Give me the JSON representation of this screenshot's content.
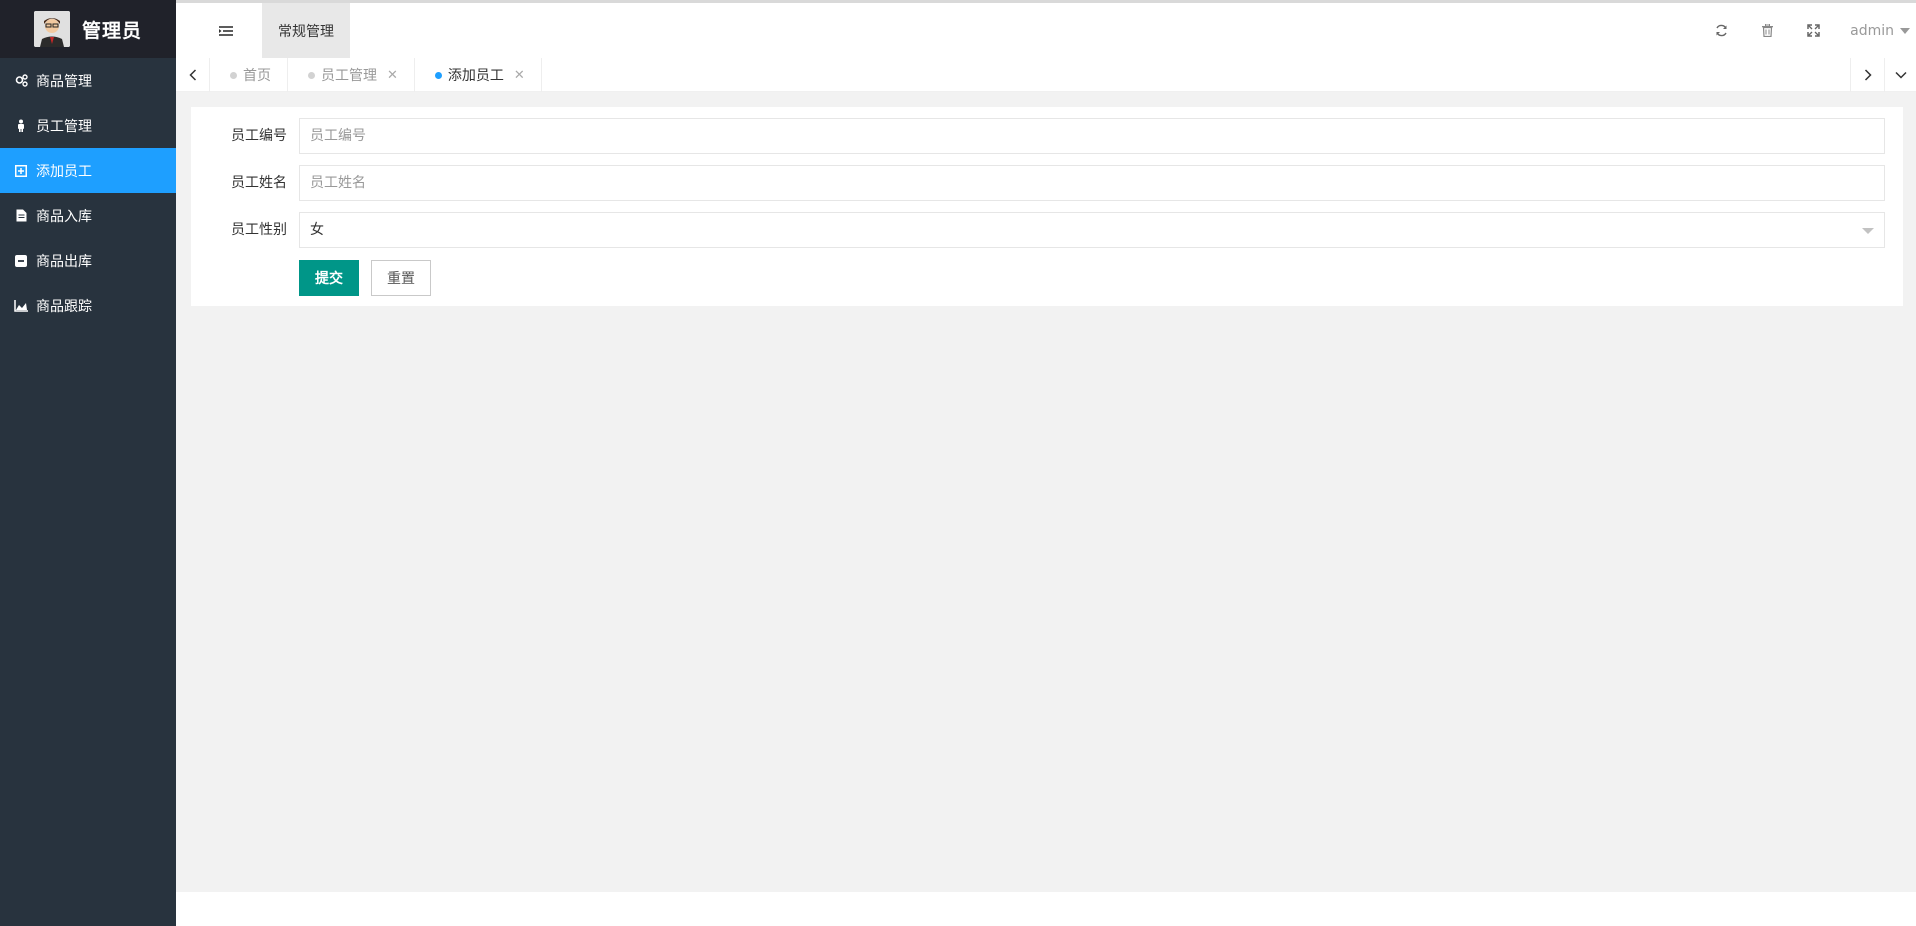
{
  "sidebar": {
    "logo_text": "管理员",
    "items": [
      {
        "label": "商品管理",
        "icon": "gears-icon",
        "active": false
      },
      {
        "label": "员工管理",
        "icon": "person-icon",
        "active": false
      },
      {
        "label": "添加员工",
        "icon": "add-square-icon",
        "active": true
      },
      {
        "label": "商品入库",
        "icon": "file-icon",
        "active": false
      },
      {
        "label": "商品出库",
        "icon": "minus-square-icon",
        "active": false
      },
      {
        "label": "商品跟踪",
        "icon": "area-chart-icon",
        "active": false
      }
    ]
  },
  "header": {
    "nav_label": "常规管理",
    "user": "admin",
    "tools": [
      "refresh-icon",
      "trash-icon",
      "fullscreen-icon"
    ]
  },
  "tabs": [
    {
      "label": "首页",
      "active": false,
      "closable": false
    },
    {
      "label": "员工管理",
      "active": false,
      "closable": true
    },
    {
      "label": "添加员工",
      "active": true,
      "closable": true
    }
  ],
  "form": {
    "emp_no": {
      "label": "员工编号",
      "placeholder": "员工编号",
      "value": ""
    },
    "emp_name": {
      "label": "员工姓名",
      "placeholder": "员工姓名",
      "value": ""
    },
    "emp_gender": {
      "label": "员工性别",
      "value": "女"
    },
    "submit_label": "提交",
    "reset_label": "重置"
  },
  "colors": {
    "sidebar_bg": "#28333e",
    "active_menu": "#1e9fff",
    "primary_button": "#009688"
  }
}
